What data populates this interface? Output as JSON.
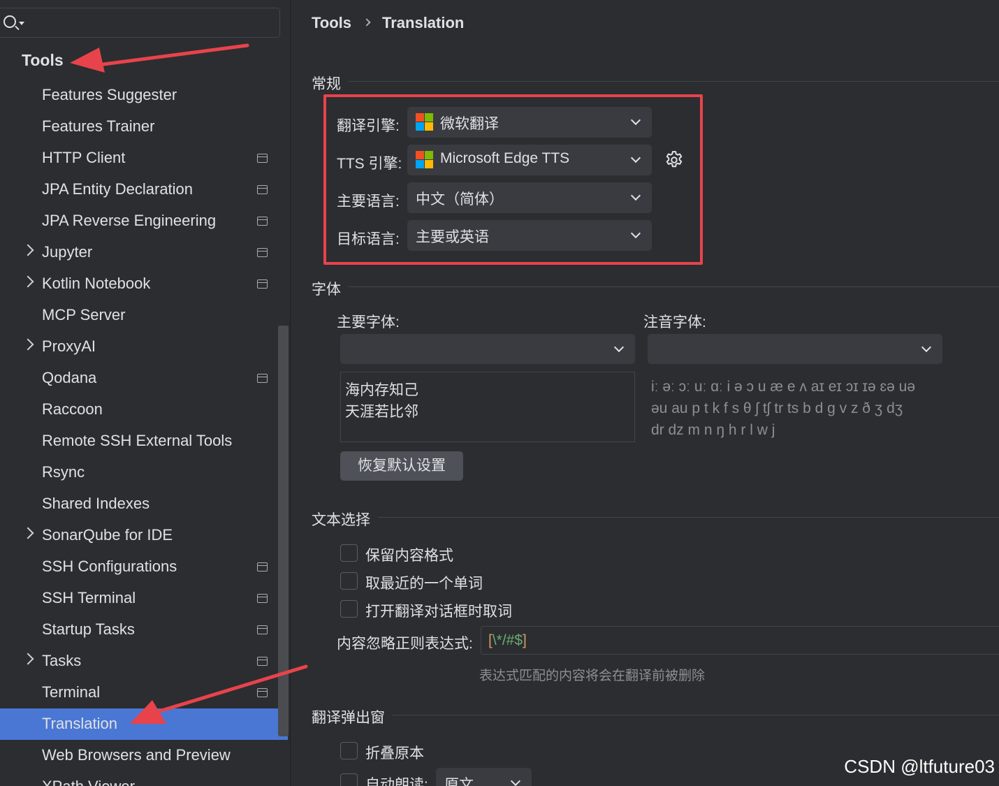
{
  "search": {
    "placeholder": "",
    "value": ""
  },
  "sidebar": {
    "header": "Tools",
    "items": [
      {
        "label": "Features Suggester",
        "expandable": false,
        "project_icon": false
      },
      {
        "label": "Features Trainer",
        "expandable": false,
        "project_icon": false
      },
      {
        "label": "HTTP Client",
        "expandable": false,
        "project_icon": true
      },
      {
        "label": "JPA Entity Declaration",
        "expandable": false,
        "project_icon": true
      },
      {
        "label": "JPA Reverse Engineering",
        "expandable": false,
        "project_icon": true
      },
      {
        "label": "Jupyter",
        "expandable": true,
        "project_icon": true
      },
      {
        "label": "Kotlin Notebook",
        "expandable": true,
        "project_icon": true
      },
      {
        "label": "MCP Server",
        "expandable": false,
        "project_icon": false
      },
      {
        "label": "ProxyAI",
        "expandable": true,
        "project_icon": false
      },
      {
        "label": "Qodana",
        "expandable": false,
        "project_icon": true
      },
      {
        "label": "Raccoon",
        "expandable": false,
        "project_icon": false
      },
      {
        "label": "Remote SSH External Tools",
        "expandable": false,
        "project_icon": false
      },
      {
        "label": "Rsync",
        "expandable": false,
        "project_icon": false
      },
      {
        "label": "Shared Indexes",
        "expandable": false,
        "project_icon": false
      },
      {
        "label": "SonarQube for IDE",
        "expandable": true,
        "project_icon": false
      },
      {
        "label": "SSH Configurations",
        "expandable": false,
        "project_icon": true
      },
      {
        "label": "SSH Terminal",
        "expandable": false,
        "project_icon": true
      },
      {
        "label": "Startup Tasks",
        "expandable": false,
        "project_icon": true
      },
      {
        "label": "Tasks",
        "expandable": true,
        "project_icon": true
      },
      {
        "label": "Terminal",
        "expandable": false,
        "project_icon": true
      },
      {
        "label": "Translation",
        "expandable": false,
        "project_icon": false,
        "selected": true
      },
      {
        "label": "Web Browsers and Preview",
        "expandable": false,
        "project_icon": false
      },
      {
        "label": "XPath Viewer",
        "expandable": false,
        "project_icon": false
      }
    ]
  },
  "breadcrumb": {
    "parent": "Tools",
    "current": "Translation"
  },
  "general": {
    "title": "常规",
    "engine_label": "翻译引擎:",
    "engine_value": "微软翻译",
    "tts_label": "TTS 引擎:",
    "tts_value": "Microsoft Edge TTS",
    "primary_lang_label": "主要语言:",
    "primary_lang_value": "中文（简体）",
    "target_lang_label": "目标语言:",
    "target_lang_value": "主要或英语"
  },
  "font": {
    "title": "字体",
    "primary_label": "主要字体:",
    "phonetic_label": "注音字体:",
    "primary_value": "",
    "phonetic_value": "",
    "preview_lines": [
      "海内存知己",
      "天涯若比邻"
    ],
    "phonetic_lines": [
      "iː əː ɔː uː ɑː i ə ɔ u æ e ʌ aɪ eɪ ɔɪ ɪə ɛə uə",
      "əu au p t k f s θ ʃ tʃ tr ts b d g v z ð ʒ dʒ",
      "dr dz m n ŋ h r l w j"
    ],
    "reset_button": "恢复默认设置"
  },
  "text_selection": {
    "title": "文本选择",
    "options": [
      "保留内容格式",
      "取最近的一个单词",
      "打开翻译对话框时取词"
    ],
    "regex_label": "内容忽略正则表达式:",
    "regex_value": "[\\*/#$]",
    "regex_hint": "表达式匹配的内容将会在翻译前被删除"
  },
  "popup": {
    "title": "翻译弹出窗",
    "fold_label": "折叠原本",
    "autoread_label": "自动朗读:",
    "autoread_value": "原文"
  },
  "watermark": "CSDN @ltfuture03",
  "colors": {
    "background": "#2b2d30",
    "selection": "#4a77d4",
    "highlight_box": "#e8434b",
    "regex_bracket": "#d19a66",
    "regex_body": "#6aab73"
  }
}
